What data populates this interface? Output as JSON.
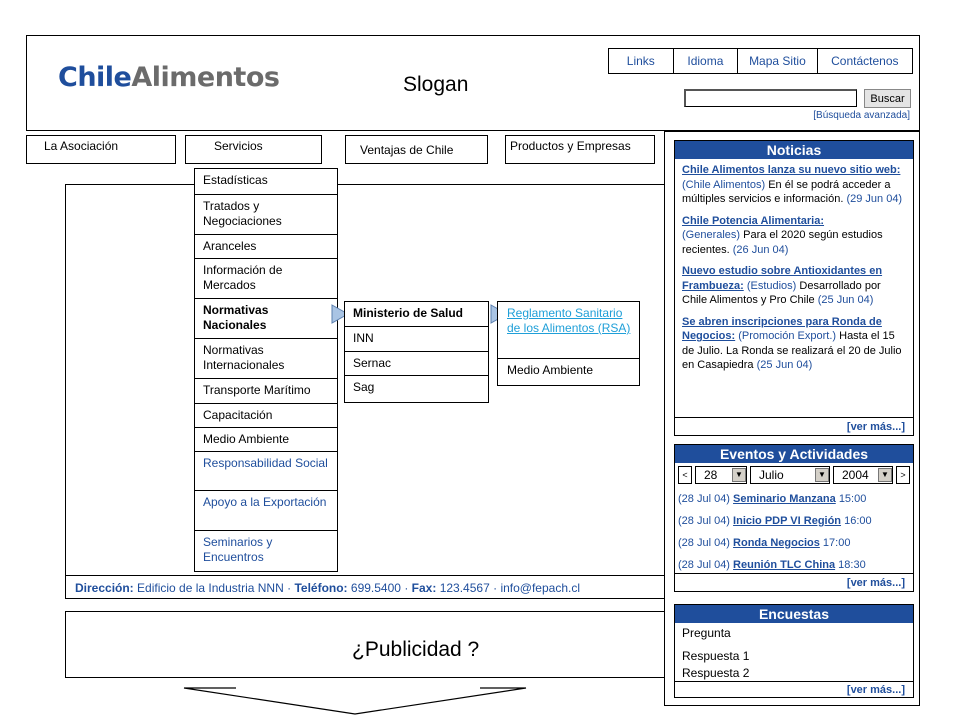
{
  "brand": {
    "logo_part1": "Chile",
    "logo_part2": "Alimentos",
    "slogan": "Slogan"
  },
  "toplinks": [
    "Links",
    "Idioma",
    "Mapa Sitio",
    "Contáctenos"
  ],
  "search": {
    "button": "Buscar",
    "advanced": "[Búsqueda avanzada]"
  },
  "nav": [
    "La Asociación",
    "Servicios",
    "Ventajas de Chile",
    "Productos y Empresas"
  ],
  "services_menu": [
    "Estadísticas",
    "Tratados y Negociaciones",
    "Aranceles",
    "Información de Mercados",
    "Normativas Nacionales",
    "Normativas Internacionales",
    "Transporte Marítimo",
    "Capacitación",
    "Medio Ambiente",
    "Responsabilidad Social",
    "Apoyo a la Exportación",
    "Seminarios y Encuentros"
  ],
  "submenu": [
    "Ministerio de Salud",
    "INN",
    "Sernac",
    "Sag"
  ],
  "subsubmenu": [
    "Reglamento Sanitario de los Alimentos (RSA)",
    "Medio Ambiente"
  ],
  "footer": {
    "dir_label": "Dirección:",
    "dir_value": "Edificio de la Industria NNN",
    "tel_label": "Teléfono:",
    "tel_value": "699.5400",
    "fax_label": "Fax:",
    "fax_value": "123.4567",
    "email": "info@fepach.cl"
  },
  "ad": {
    "text": "¿Publicidad ?"
  },
  "news": {
    "title": "Noticias",
    "items": [
      {
        "headline": "Chile Alimentos lanza su nuevo sitio web:",
        "category": "(Chile Alimentos)",
        "text": "En él se podrá acceder a múltiples servicios e información.",
        "date": "(29 Jun 04)"
      },
      {
        "headline": "Chile Potencia Alimentaria:",
        "category": "(Generales)",
        "text": "Para el 2020 según estudios recientes.",
        "date": "(26 Jun 04)"
      },
      {
        "headline": "Nuevo estudio sobre Antioxidantes en Frambueza:",
        "category": "(Estudios)",
        "text": "Desarrollado por Chile Alimentos y Pro Chile",
        "date": "(25 Jun 04)"
      },
      {
        "headline": "Se abren inscripciones para Ronda de Negocios:",
        "category": "(Promoción Export.)",
        "text": "Hasta el 15 de Julio. La Ronda se realizará el 20 de Julio en Casapiedra",
        "date": "(25 Jun 04)"
      }
    ],
    "more": "[ver más...]"
  },
  "events": {
    "title": "Eventos y Actividades",
    "day": "28",
    "month": "Julio",
    "year": "2004",
    "items": [
      {
        "date": "(28 Jul 04)",
        "name": "Seminario Manzana",
        "time": "15:00"
      },
      {
        "date": "(28 Jul 04)",
        "name": "Inicio PDP VI Región",
        "time": "16:00"
      },
      {
        "date": "(28 Jul 04)",
        "name": "Ronda Negocios",
        "time": "17:00"
      },
      {
        "date": "(28 Jul 04)",
        "name": "Reunión TLC China",
        "time": "18:30"
      }
    ],
    "more": "[ver más...]"
  },
  "polls": {
    "title": "Encuestas",
    "question": "Pregunta",
    "answers": [
      "Respuesta 1",
      "Respuesta 2"
    ],
    "more": "[ver más...]"
  },
  "colors": {
    "accent": "#1f4e9c",
    "arrow": "#a9c4e4"
  }
}
